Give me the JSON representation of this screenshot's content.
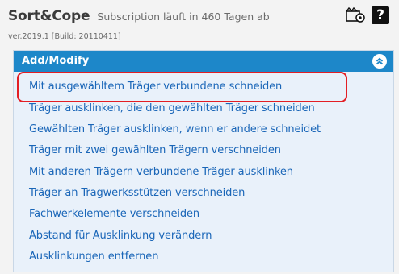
{
  "header": {
    "app_name": "Sort&Cope",
    "subscription": "Subscription läuft in 460 Tagen ab",
    "version": "ver.2019.1 [Build: 20110411]",
    "icons": [
      "video-settings-icon",
      "help-icon"
    ],
    "help_glyph": "?"
  },
  "panel": {
    "title": "Add/Modify",
    "collapse_icon": "chevron-double-up-icon",
    "header_color": "#1d87c9",
    "link_color": "#1a66b8",
    "highlight_color": "#e31e24",
    "items": [
      {
        "label": "Mit ausgewähltem Träger verbundene schneiden",
        "highlighted": true
      },
      {
        "label": "Träger ausklinken, die den gewählten Träger schneiden"
      },
      {
        "label": "Gewählten Träger ausklinken, wenn er andere schneidet"
      },
      {
        "label": "Träger mit zwei gewählten Trägern verschneiden"
      },
      {
        "label": "Mit anderen Trägern verbundene Träger ausklinken"
      },
      {
        "label": "Träger an Tragwerksstützen verschneiden"
      },
      {
        "label": "Fachwerkelemente verschneiden"
      },
      {
        "label": "Abstand für Ausklinkung verändern"
      },
      {
        "label": "Ausklinkungen entfernen"
      }
    ]
  }
}
